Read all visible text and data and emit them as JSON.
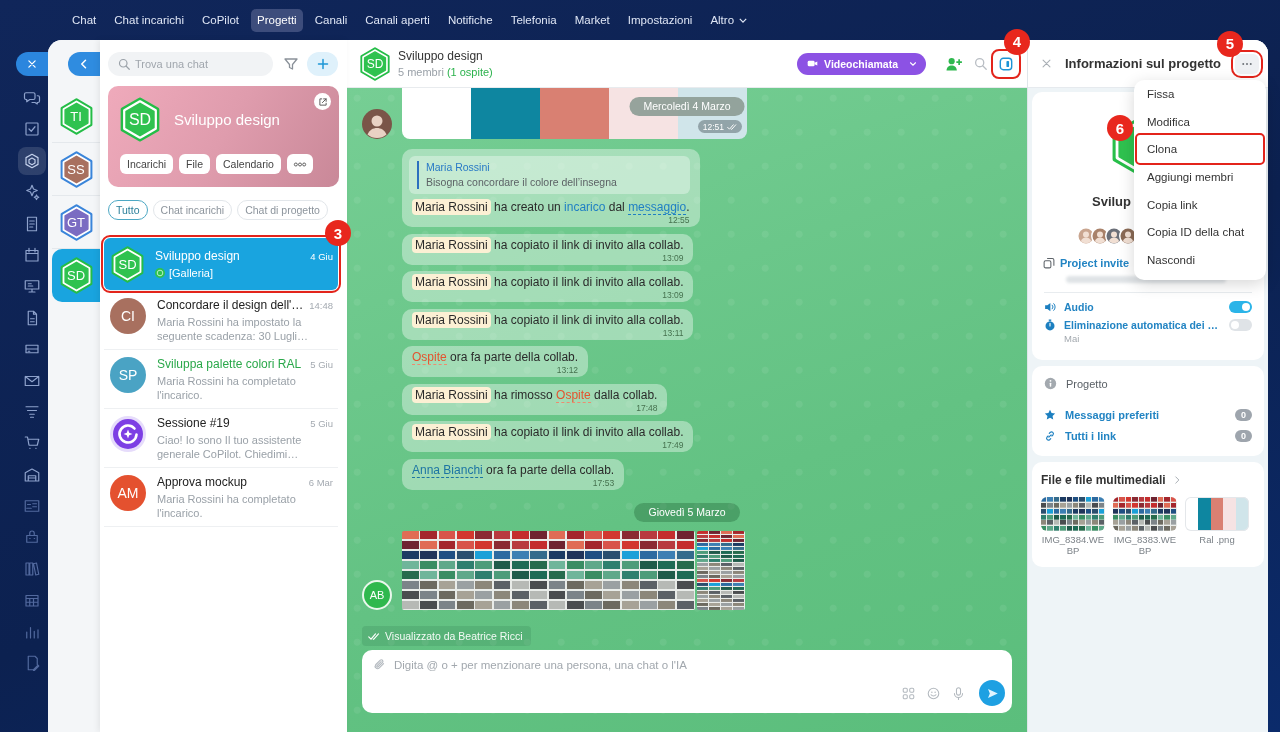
{
  "nav": {
    "items": [
      {
        "label": "Chat",
        "selected": false,
        "dropdown": false
      },
      {
        "label": "Chat incarichi",
        "selected": false,
        "dropdown": false
      },
      {
        "label": "CoPilot",
        "selected": false,
        "dropdown": false
      },
      {
        "label": "Progetti",
        "selected": true,
        "dropdown": false
      },
      {
        "label": "Canali",
        "selected": false,
        "dropdown": false
      },
      {
        "label": "Canali aperti",
        "selected": false,
        "dropdown": false
      },
      {
        "label": "Notifiche",
        "selected": false,
        "dropdown": false
      },
      {
        "label": "Telefonia",
        "selected": false,
        "dropdown": false
      },
      {
        "label": "Market",
        "selected": false,
        "dropdown": false
      },
      {
        "label": "Impostazioni",
        "selected": false,
        "dropdown": false
      },
      {
        "label": "Altro",
        "selected": false,
        "dropdown": true
      }
    ]
  },
  "rail": {
    "items": [
      {
        "selected": false
      },
      {
        "selected": false
      },
      {
        "selected": true
      },
      {
        "selected": false
      },
      {
        "selected": false
      },
      {
        "selected": false
      },
      {
        "selected": false
      },
      {
        "selected": false
      },
      {
        "selected": false
      },
      {
        "selected": false
      },
      {
        "selected": false
      },
      {
        "selected": false
      },
      {
        "selected": false
      },
      {
        "selected": false
      },
      {
        "selected": false
      },
      {
        "selected": false
      },
      {
        "selected": false
      },
      {
        "selected": false
      },
      {
        "selected": false
      }
    ]
  },
  "recent": {
    "items": [
      {
        "initials": "TI",
        "kind": "collab",
        "color": "#2fc24f",
        "selected": false
      },
      {
        "initials": "SS",
        "kind": "group",
        "color": "#a8705f",
        "selected": false
      },
      {
        "initials": "GT",
        "kind": "group",
        "color": "#7b6cc2",
        "selected": false
      },
      {
        "initials": "SD",
        "kind": "collab",
        "color": "#2fc24f",
        "selected": true
      }
    ]
  },
  "chat_list": {
    "search": {
      "placeholder": "Trova una chat"
    },
    "project_card": {
      "initials": "SD",
      "title": "Sviluppo design",
      "buttons": [
        "Incarichi",
        "File",
        "Calendario"
      ]
    },
    "filters": [
      {
        "label": "Tutto",
        "selected": true
      },
      {
        "label": "Chat incarichi",
        "selected": false
      },
      {
        "label": "Chat di progetto",
        "selected": false
      }
    ],
    "items": [
      {
        "kind": "project",
        "initials": "SD",
        "color": "#2fc24f",
        "title": "Sviluppo design",
        "time": "4 Giu",
        "preview": "[Galleria]",
        "author_icon": true,
        "selected": true,
        "accented": false,
        "callout": "3"
      },
      {
        "kind": "task",
        "initials": "CI",
        "color": "#a8705f",
        "title": "Concordare il design dell'…",
        "time": "14:48",
        "preview": "Maria Rossini ha impostato la seguente scadenza: 30 Lugli…",
        "author_icon": false,
        "selected": false,
        "accented": false
      },
      {
        "kind": "task",
        "initials": "SP",
        "color": "#4aa3c4",
        "title": "Sviluppa palette colori RAL",
        "time": "5 Giu",
        "preview": "Maria Rossini ha completato l'incarico.",
        "author_icon": false,
        "selected": false,
        "accented": true
      },
      {
        "kind": "assistant",
        "title": "Sessione #19",
        "time": "5 Giu",
        "preview": "Ciao! Io sono Il tuo assistente generale CoPilot. Chiedimi…",
        "author_icon": false,
        "selected": false,
        "accented": false
      },
      {
        "kind": "task",
        "initials": "AM",
        "color": "#e4512f",
        "title": "Approva mockup",
        "time": "6 Mar",
        "preview": "Maria Rossini ha completato l'incarico.",
        "author_icon": false,
        "selected": false,
        "accented": false
      }
    ]
  },
  "chat": {
    "header": {
      "initials": "SD",
      "title": "Sviluppo design",
      "members": "5 membri",
      "guests": "(1 ospite)",
      "video_button": "Videochiamata",
      "panel_button": {
        "selected": true,
        "callout": "4"
      }
    },
    "date_header": "Mercoledì 4 Marzo",
    "feed": [
      {
        "kind": "image",
        "avatar": {
          "kind": "photo"
        },
        "time": "12:51",
        "read": true
      },
      {
        "kind": "system",
        "quote": {
          "author": "Maria Rossini",
          "text": "Bisogna concordare il colore dell’insegna"
        },
        "segments": [
          {
            "kind": "mention",
            "text": "Maria Rossini"
          },
          {
            "kind": "text",
            "text": " ha creato un "
          },
          {
            "kind": "link",
            "text": "incarico"
          },
          {
            "kind": "text",
            "text": " dal "
          },
          {
            "kind": "dotted-link",
            "text": "messaggio"
          },
          {
            "kind": "text",
            "text": "."
          }
        ],
        "time": "12:55"
      },
      {
        "kind": "system",
        "segments": [
          {
            "kind": "mention",
            "text": "Maria Rossini"
          },
          {
            "kind": "text",
            "text": " ha copiato il link di invito alla collab."
          }
        ],
        "time": "13:09"
      },
      {
        "kind": "system",
        "segments": [
          {
            "kind": "mention",
            "text": "Maria Rossini"
          },
          {
            "kind": "text",
            "text": " ha copiato il link di invito alla collab."
          }
        ],
        "time": "13:09"
      },
      {
        "kind": "system",
        "segments": [
          {
            "kind": "mention",
            "text": "Maria Rossini"
          },
          {
            "kind": "text",
            "text": " ha copiato il link di invito alla collab."
          }
        ],
        "time": "13:11"
      },
      {
        "kind": "system",
        "segments": [
          {
            "kind": "guest-link",
            "text": "Ospite"
          },
          {
            "kind": "text",
            "text": " ora fa parte della collab."
          }
        ],
        "time": "13:12"
      },
      {
        "kind": "system",
        "segments": [
          {
            "kind": "mention",
            "text": "Maria Rossini"
          },
          {
            "kind": "text",
            "text": " ha rimosso "
          },
          {
            "kind": "guest-link",
            "text": "Ospite"
          },
          {
            "kind": "text",
            "text": " dalla collab."
          }
        ],
        "time": "17:48"
      },
      {
        "kind": "system",
        "segments": [
          {
            "kind": "mention",
            "text": "Maria Rossini"
          },
          {
            "kind": "text",
            "text": " ha copiato il link di invito alla collab."
          }
        ],
        "time": "17:49"
      },
      {
        "kind": "system",
        "segments": [
          {
            "kind": "user-link",
            "text": "Anna Bianchi"
          },
          {
            "kind": "text",
            "text": " ora fa parte della collab."
          }
        ],
        "time": "17:53"
      },
      {
        "kind": "date",
        "text": "Giovedì 5 Marzo"
      },
      {
        "kind": "gallery",
        "avatar": {
          "kind": "initials",
          "initials": "AB"
        }
      }
    ],
    "seen_by": "Visualizzato da Beatrice Ricci",
    "composer": {
      "placeholder": "Digita @ o + per menzionare una persona, una chat o l'IA"
    }
  },
  "info_panel": {
    "title": "Informazioni sul progetto",
    "more_callout": "5",
    "name": "Svilup",
    "invite_link": "Project invite",
    "settings": [
      {
        "label": "Audio",
        "on": true
      },
      {
        "label": "Eliminazione automatica dei …",
        "on": false,
        "note": "Mai"
      }
    ],
    "section": "Progetto",
    "links": [
      {
        "label": "Messaggi preferiti",
        "count": "0"
      },
      {
        "label": "Tutti i link",
        "count": "0"
      }
    ],
    "files": {
      "title": "File e file multimediali",
      "items": [
        {
          "name": "IMG_8384.WEBP",
          "kind": "grid"
        },
        {
          "name": "IMG_8383.WEBP",
          "kind": "grid"
        },
        {
          "name": "Ral .png",
          "kind": "stripes"
        }
      ]
    }
  },
  "menu": {
    "items": [
      {
        "label": "Fissa"
      },
      {
        "label": "Modifica"
      },
      {
        "label": "Clona",
        "callout": "6"
      },
      {
        "label": "Aggiungi membri"
      },
      {
        "label": "Copia link"
      },
      {
        "label": "Copia ID della chat"
      },
      {
        "label": "Nascondi"
      }
    ]
  }
}
